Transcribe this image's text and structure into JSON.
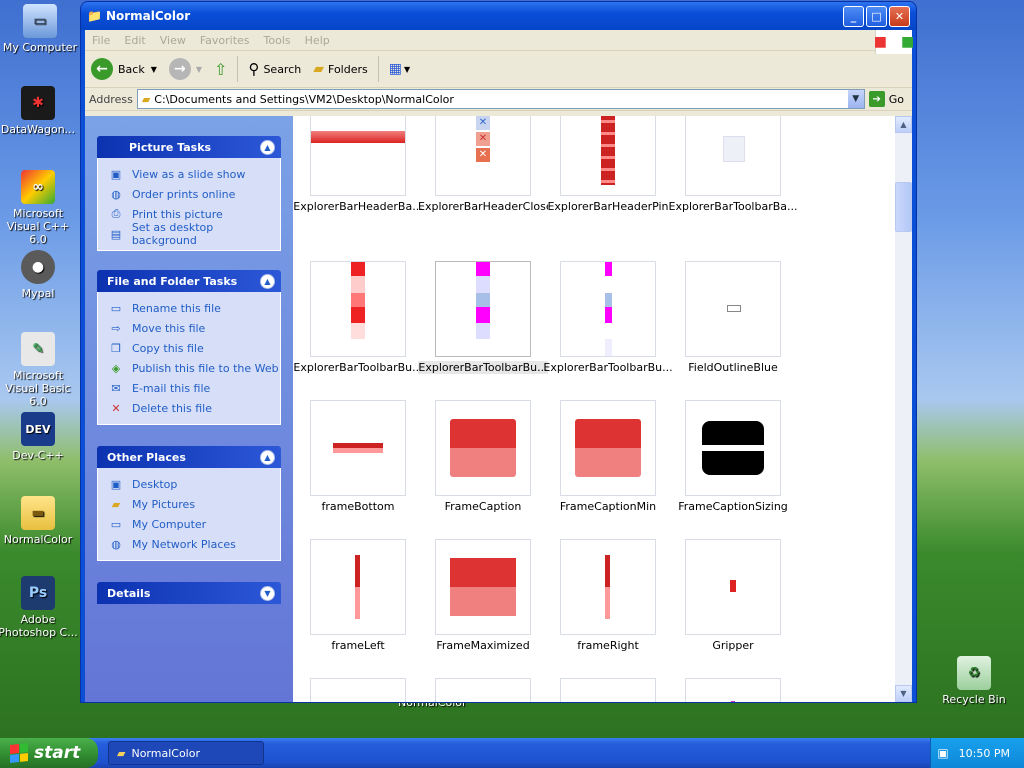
{
  "desktop": {
    "icons": [
      {
        "label": "My Computer"
      },
      {
        "label": "DataWagon..."
      },
      {
        "label": "Microsoft Visual C++ 6.0"
      },
      {
        "label": "Mypal"
      },
      {
        "label": "Microsoft Visual Basic 6.0"
      },
      {
        "label": "Dev-C++"
      },
      {
        "label": "NormalColor"
      },
      {
        "label": "Adobe Photoshop C..."
      },
      {
        "label": "Recycle Bin"
      }
    ],
    "partial_label": "NormalColor"
  },
  "window": {
    "title": "NormalColor",
    "menu": [
      "File",
      "Edit",
      "View",
      "Favorites",
      "Tools",
      "Help"
    ],
    "toolbar": {
      "back": "Back",
      "search": "Search",
      "folders": "Folders"
    },
    "address": {
      "label": "Address",
      "path": "C:\\Documents and Settings\\VM2\\Desktop\\NormalColor",
      "go": "Go"
    }
  },
  "taskpane": {
    "picture_tasks": {
      "title": "Picture Tasks",
      "items": [
        "View as a slide show",
        "Order prints online",
        "Print this picture",
        "Set as desktop background"
      ]
    },
    "file_tasks": {
      "title": "File and Folder Tasks",
      "items": [
        "Rename this file",
        "Move this file",
        "Copy this file",
        "Publish this file to the Web",
        "E-mail this file",
        "Delete this file"
      ]
    },
    "other_places": {
      "title": "Other Places",
      "items": [
        "Desktop",
        "My Pictures",
        "My Computer",
        "My Network Places"
      ]
    },
    "details": {
      "title": "Details"
    }
  },
  "files": [
    {
      "name": "ExplorerBarHeaderBa..."
    },
    {
      "name": "ExplorerBarHeaderClose"
    },
    {
      "name": "ExplorerBarHeaderPin"
    },
    {
      "name": "ExplorerBarToolbarBa..."
    },
    {
      "name": "ExplorerBarToolbarBu..."
    },
    {
      "name": "ExplorerBarToolbarBu...",
      "selected": true
    },
    {
      "name": "ExplorerBarToolbarBu..."
    },
    {
      "name": "FieldOutlineBlue"
    },
    {
      "name": "frameBottom"
    },
    {
      "name": "FrameCaption"
    },
    {
      "name": "FrameCaptionMin"
    },
    {
      "name": "FrameCaptionSizing"
    },
    {
      "name": "frameLeft"
    },
    {
      "name": "FrameMaximized"
    },
    {
      "name": "frameRight"
    },
    {
      "name": "Gripper"
    }
  ],
  "taskbar": {
    "start": "start",
    "task": "NormalColor",
    "clock": "10:50 PM"
  }
}
